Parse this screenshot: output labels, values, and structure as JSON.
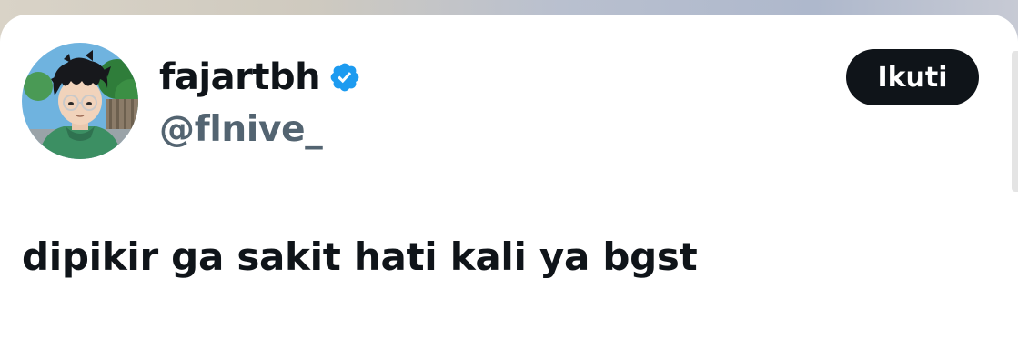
{
  "profile": {
    "display_name": "fajartbh",
    "handle": "@flnive_",
    "verified_icon": "verified-badge-icon",
    "avatar_icon": "anime-avatar"
  },
  "actions": {
    "follow_label": "Ikuti"
  },
  "tweet": {
    "text": "dipikir ga sakit hati kali ya bgst"
  },
  "colors": {
    "text_primary": "#0f1419",
    "text_secondary": "#536471",
    "verified_blue": "#1d9bf0",
    "button_bg": "#0f1419",
    "button_text": "#ffffff"
  }
}
